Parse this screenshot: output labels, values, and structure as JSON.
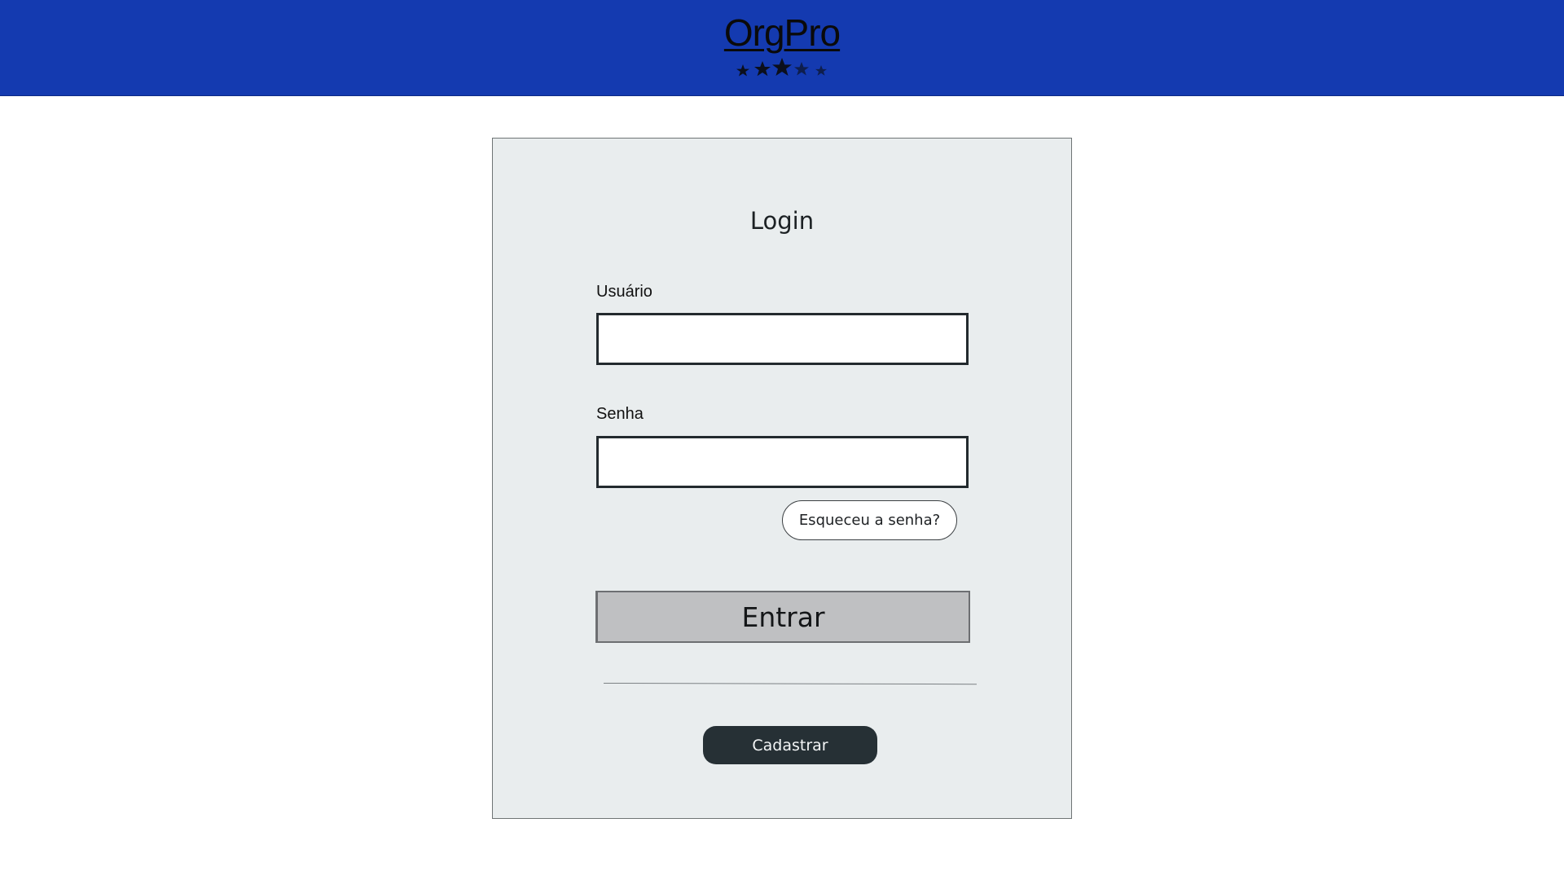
{
  "header": {
    "brand": "OrgPro",
    "rating": {
      "value": 3,
      "max": 5,
      "icon": "star-icon"
    },
    "background_color": "#143ab0"
  },
  "login": {
    "title": "Login",
    "username": {
      "label": "Usuário",
      "value": "",
      "placeholder": ""
    },
    "password": {
      "label": "Senha",
      "value": "",
      "placeholder": ""
    },
    "forgot_label": "Esqueceu a senha?",
    "enter_label": "Entrar",
    "signup_label": "Cadastrar"
  },
  "colors": {
    "card_background": "#e9edee",
    "enter_button": "#bfc0c2",
    "signup_button": "#263035"
  }
}
